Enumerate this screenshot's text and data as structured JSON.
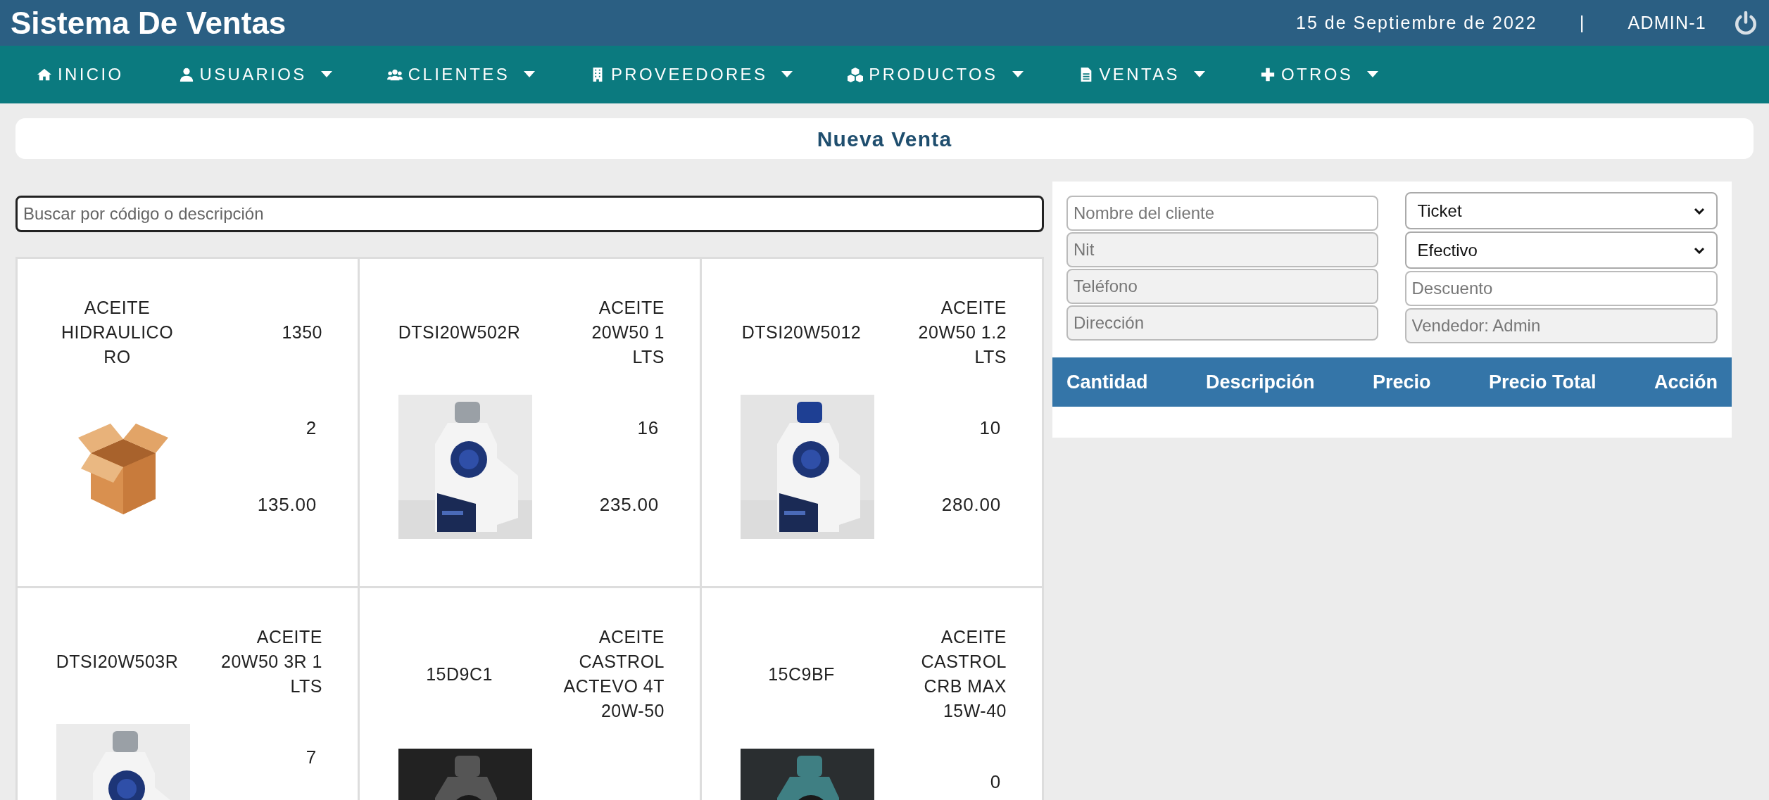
{
  "header": {
    "title": "Sistema De Ventas",
    "date": "15 de Septiembre de 2022",
    "separator": "|",
    "user": "ADMIN-1"
  },
  "nav": [
    {
      "label": "INICIO",
      "dropdown": false
    },
    {
      "label": "USUARIOS",
      "dropdown": true
    },
    {
      "label": "CLIENTES",
      "dropdown": true
    },
    {
      "label": "PROVEEDORES",
      "dropdown": true
    },
    {
      "label": "PRODUCTOS",
      "dropdown": true
    },
    {
      "label": "VENTAS",
      "dropdown": true
    },
    {
      "label": "OTROS",
      "dropdown": true
    }
  ],
  "page_title": "Nueva Venta",
  "search": {
    "placeholder": "Buscar por código o descripción"
  },
  "products": [
    {
      "left_text": "ACEITE HIDRAULICO RO",
      "right_text": "1350",
      "kind": "box",
      "stock": "2",
      "price": "135.00"
    },
    {
      "left_text": "DTSI20W502R",
      "right_text": "ACEITE 20W50 1 LTS",
      "kind": "picture",
      "stock": "16",
      "price": "235.00"
    },
    {
      "left_text": "DTSI20W5012",
      "right_text": "ACEITE 20W50 1.2 LTS",
      "kind": "picture",
      "stock": "10",
      "price": "280.00"
    },
    {
      "left_text": "DTSI20W503R",
      "right_text": "ACEITE 20W50 3R 1 LTS",
      "kind": "picture",
      "stock": "7"
    },
    {
      "left_text": "15D9C1",
      "right_text": "ACEITE CASTROL ACTEVO 4T 20W-50",
      "kind": "picture"
    },
    {
      "left_text": "15C9BF",
      "right_text": "ACEITE CASTROL CRB MAX 15W-40",
      "kind": "picture",
      "stock": "0"
    }
  ],
  "customer_fields": [
    {
      "placeholder": "Nombre del cliente",
      "disabled": false
    },
    {
      "placeholder": "Nit",
      "disabled": true
    },
    {
      "placeholder": "Teléfono",
      "disabled": true
    },
    {
      "placeholder": "Dirección",
      "disabled": true
    }
  ],
  "sale_options": [
    {
      "kind": "select",
      "value": "Ticket"
    },
    {
      "kind": "select",
      "value": "Efectivo"
    },
    {
      "kind": "input",
      "placeholder": "Descuento",
      "disabled": false
    },
    {
      "kind": "input",
      "placeholder": "Vendedor: Admin",
      "disabled": true
    }
  ],
  "cart_table": {
    "columns": [
      "Cantidad",
      "Descripción",
      "Precio",
      "Precio Total",
      "Acción"
    ]
  }
}
